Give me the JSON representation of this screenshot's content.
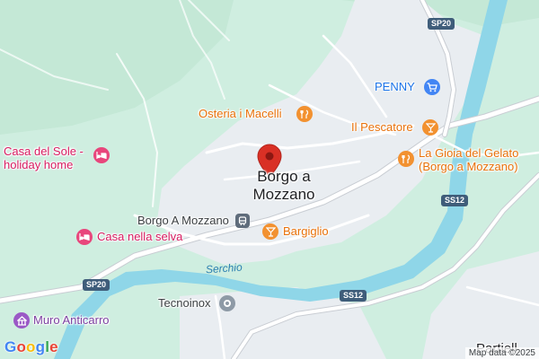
{
  "colors": {
    "land": "#cfeee0",
    "urban": "#e9edf1",
    "water": "#8fd6e8",
    "road": "#ffffff",
    "road_casing": "#c9cdd3",
    "marker": "#d93025",
    "pink": "#d81b60",
    "orange": "#e8710a",
    "blue": "#1a73e8",
    "purple": "#7b3fa0",
    "gray": "#757575"
  },
  "places": {
    "town_line1": "Borgo a",
    "town_line2": "Mozzano",
    "station": "Borgo A Mozzano",
    "partial_bottom": "Partiell"
  },
  "pois": {
    "casa_sole_line1": "Casa del Sole -",
    "casa_sole_line2": "holiday home",
    "casa_selva": "Casa nella selva",
    "muro": "Muro Anticarro",
    "osteria": "Osteria i Macelli",
    "pescatore": "Il Pescatore",
    "gelato_line1": "La Gioia del Gelato",
    "gelato_line2": "(Borgo a Mozzano)",
    "bargiglio": "Bargiglio",
    "penny": "PENNY",
    "tecnoinox": "Tecnoinox"
  },
  "icons": {
    "lodging": "bed-icon",
    "restaurant": "fork-knife-icon",
    "bar": "cocktail-icon",
    "shopping": "cart-icon",
    "landmark": "monument-icon",
    "business": "circle-icon",
    "transit": "train-icon",
    "marker": "map-pin-icon"
  },
  "roads": {
    "sp20_top": "SP20",
    "sp20_left": "SP20",
    "ss12_right": "SS12",
    "ss12_bottom": "SS12"
  },
  "water": {
    "river": "Serchio"
  },
  "footer": {
    "logo": "Google",
    "attribution": "Map data ©2025"
  }
}
